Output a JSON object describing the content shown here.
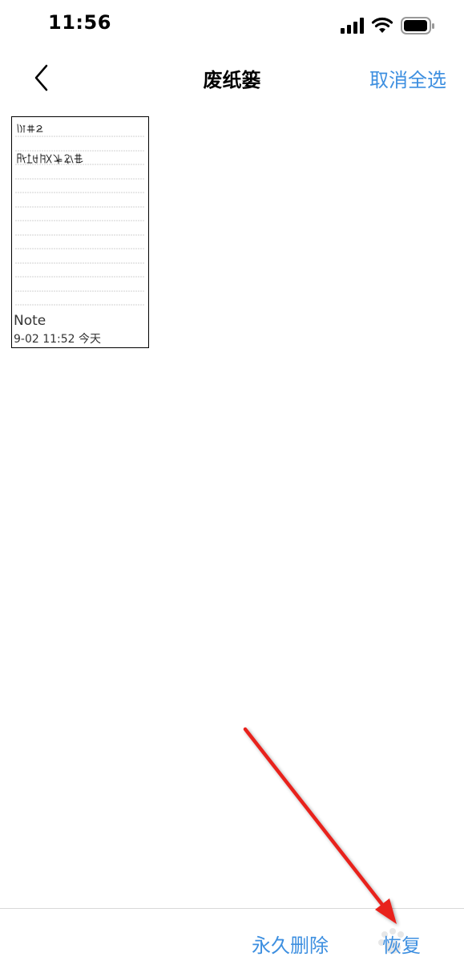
{
  "status_bar": {
    "time": "11:56"
  },
  "nav": {
    "title": "废纸篓",
    "deselect_all_label": "取消全选"
  },
  "notes": [
    {
      "title": "Note",
      "date": "9-02 11:52  今天"
    }
  ],
  "toolbar": {
    "delete_forever_label": "永久删除",
    "restore_label": "恢复"
  },
  "colors": {
    "accent": "#3d8fe0",
    "annotation": "#e8211f"
  },
  "icons": {
    "back": "chevron-left-icon",
    "signal": "cellular-signal-icon",
    "wifi": "wifi-icon",
    "battery": "battery-icon"
  }
}
